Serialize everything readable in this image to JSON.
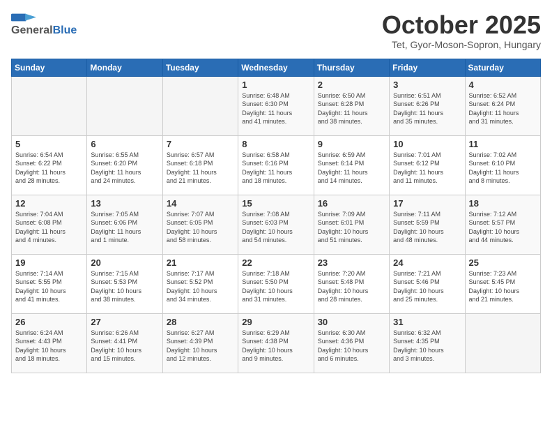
{
  "header": {
    "logo_general": "General",
    "logo_blue": "Blue",
    "month": "October 2025",
    "location": "Tet, Gyor-Moson-Sopron, Hungary"
  },
  "weekdays": [
    "Sunday",
    "Monday",
    "Tuesday",
    "Wednesday",
    "Thursday",
    "Friday",
    "Saturday"
  ],
  "weeks": [
    [
      {
        "day": "",
        "info": ""
      },
      {
        "day": "",
        "info": ""
      },
      {
        "day": "",
        "info": ""
      },
      {
        "day": "1",
        "info": "Sunrise: 6:48 AM\nSunset: 6:30 PM\nDaylight: 11 hours\nand 41 minutes."
      },
      {
        "day": "2",
        "info": "Sunrise: 6:50 AM\nSunset: 6:28 PM\nDaylight: 11 hours\nand 38 minutes."
      },
      {
        "day": "3",
        "info": "Sunrise: 6:51 AM\nSunset: 6:26 PM\nDaylight: 11 hours\nand 35 minutes."
      },
      {
        "day": "4",
        "info": "Sunrise: 6:52 AM\nSunset: 6:24 PM\nDaylight: 11 hours\nand 31 minutes."
      }
    ],
    [
      {
        "day": "5",
        "info": "Sunrise: 6:54 AM\nSunset: 6:22 PM\nDaylight: 11 hours\nand 28 minutes."
      },
      {
        "day": "6",
        "info": "Sunrise: 6:55 AM\nSunset: 6:20 PM\nDaylight: 11 hours\nand 24 minutes."
      },
      {
        "day": "7",
        "info": "Sunrise: 6:57 AM\nSunset: 6:18 PM\nDaylight: 11 hours\nand 21 minutes."
      },
      {
        "day": "8",
        "info": "Sunrise: 6:58 AM\nSunset: 6:16 PM\nDaylight: 11 hours\nand 18 minutes."
      },
      {
        "day": "9",
        "info": "Sunrise: 6:59 AM\nSunset: 6:14 PM\nDaylight: 11 hours\nand 14 minutes."
      },
      {
        "day": "10",
        "info": "Sunrise: 7:01 AM\nSunset: 6:12 PM\nDaylight: 11 hours\nand 11 minutes."
      },
      {
        "day": "11",
        "info": "Sunrise: 7:02 AM\nSunset: 6:10 PM\nDaylight: 11 hours\nand 8 minutes."
      }
    ],
    [
      {
        "day": "12",
        "info": "Sunrise: 7:04 AM\nSunset: 6:08 PM\nDaylight: 11 hours\nand 4 minutes."
      },
      {
        "day": "13",
        "info": "Sunrise: 7:05 AM\nSunset: 6:06 PM\nDaylight: 11 hours\nand 1 minute."
      },
      {
        "day": "14",
        "info": "Sunrise: 7:07 AM\nSunset: 6:05 PM\nDaylight: 10 hours\nand 58 minutes."
      },
      {
        "day": "15",
        "info": "Sunrise: 7:08 AM\nSunset: 6:03 PM\nDaylight: 10 hours\nand 54 minutes."
      },
      {
        "day": "16",
        "info": "Sunrise: 7:09 AM\nSunset: 6:01 PM\nDaylight: 10 hours\nand 51 minutes."
      },
      {
        "day": "17",
        "info": "Sunrise: 7:11 AM\nSunset: 5:59 PM\nDaylight: 10 hours\nand 48 minutes."
      },
      {
        "day": "18",
        "info": "Sunrise: 7:12 AM\nSunset: 5:57 PM\nDaylight: 10 hours\nand 44 minutes."
      }
    ],
    [
      {
        "day": "19",
        "info": "Sunrise: 7:14 AM\nSunset: 5:55 PM\nDaylight: 10 hours\nand 41 minutes."
      },
      {
        "day": "20",
        "info": "Sunrise: 7:15 AM\nSunset: 5:53 PM\nDaylight: 10 hours\nand 38 minutes."
      },
      {
        "day": "21",
        "info": "Sunrise: 7:17 AM\nSunset: 5:52 PM\nDaylight: 10 hours\nand 34 minutes."
      },
      {
        "day": "22",
        "info": "Sunrise: 7:18 AM\nSunset: 5:50 PM\nDaylight: 10 hours\nand 31 minutes."
      },
      {
        "day": "23",
        "info": "Sunrise: 7:20 AM\nSunset: 5:48 PM\nDaylight: 10 hours\nand 28 minutes."
      },
      {
        "day": "24",
        "info": "Sunrise: 7:21 AM\nSunset: 5:46 PM\nDaylight: 10 hours\nand 25 minutes."
      },
      {
        "day": "25",
        "info": "Sunrise: 7:23 AM\nSunset: 5:45 PM\nDaylight: 10 hours\nand 21 minutes."
      }
    ],
    [
      {
        "day": "26",
        "info": "Sunrise: 6:24 AM\nSunset: 4:43 PM\nDaylight: 10 hours\nand 18 minutes."
      },
      {
        "day": "27",
        "info": "Sunrise: 6:26 AM\nSunset: 4:41 PM\nDaylight: 10 hours\nand 15 minutes."
      },
      {
        "day": "28",
        "info": "Sunrise: 6:27 AM\nSunset: 4:39 PM\nDaylight: 10 hours\nand 12 minutes."
      },
      {
        "day": "29",
        "info": "Sunrise: 6:29 AM\nSunset: 4:38 PM\nDaylight: 10 hours\nand 9 minutes."
      },
      {
        "day": "30",
        "info": "Sunrise: 6:30 AM\nSunset: 4:36 PM\nDaylight: 10 hours\nand 6 minutes."
      },
      {
        "day": "31",
        "info": "Sunrise: 6:32 AM\nSunset: 4:35 PM\nDaylight: 10 hours\nand 3 minutes."
      },
      {
        "day": "",
        "info": ""
      }
    ]
  ]
}
